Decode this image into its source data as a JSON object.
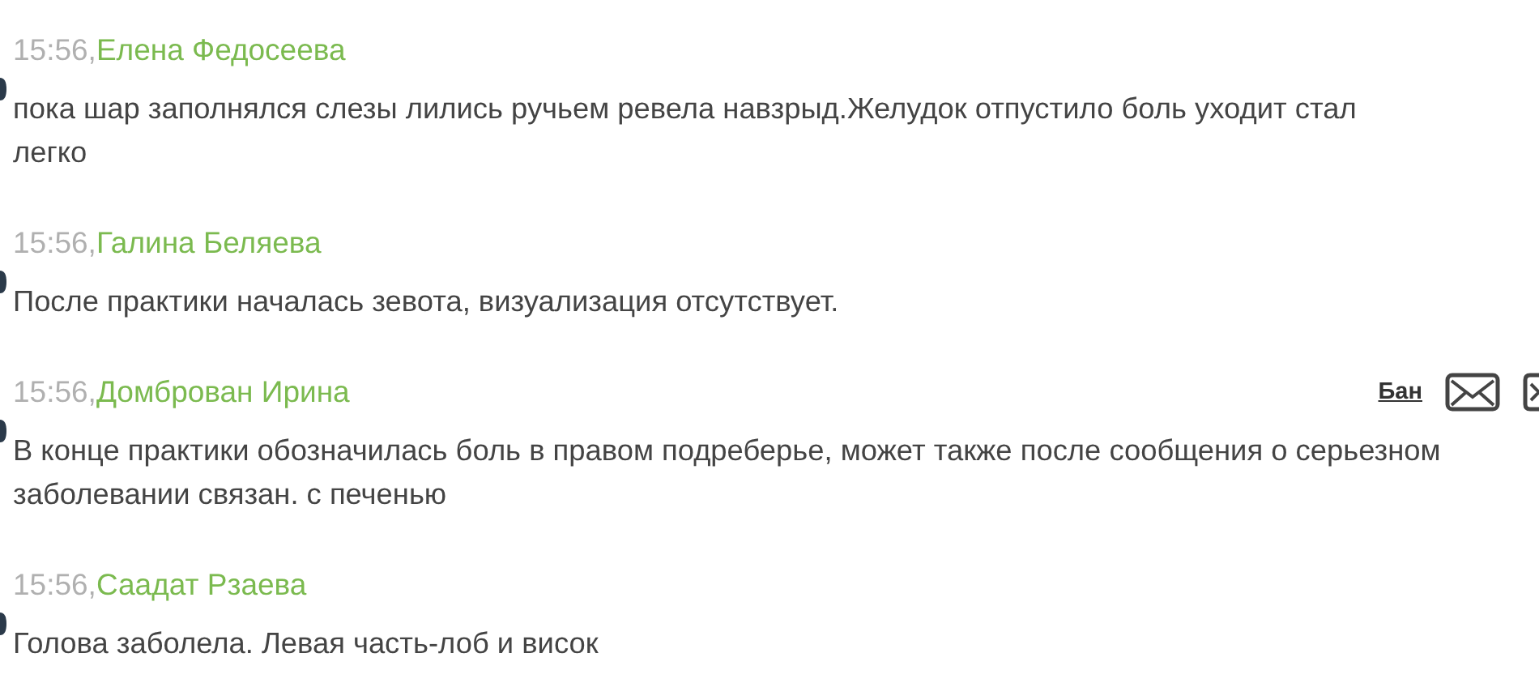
{
  "messages": [
    {
      "time": "15:56,",
      "author": "Елена Федосеева",
      "text": "пока шар заполнялся слезы лились ручьем ревела навзрыд.Желудок отпустило боль уходит стал\nлегко"
    },
    {
      "time": "15:56,",
      "author": "Галина Беляева",
      "text": "После практики началась зевота, визуализация отсутствует."
    },
    {
      "time": "15:56,",
      "author": "Домброван Ирина",
      "text": "В конце практики обозначилась боль в правом подреберье, может также после сообщения о серьезном заболевании связан. с печенью",
      "ban_link": "Бан"
    },
    {
      "time": "15:56,",
      "author": "Саадат Рзаева",
      "text": "Голова заболела. Левая часть-лоб и висок"
    }
  ]
}
